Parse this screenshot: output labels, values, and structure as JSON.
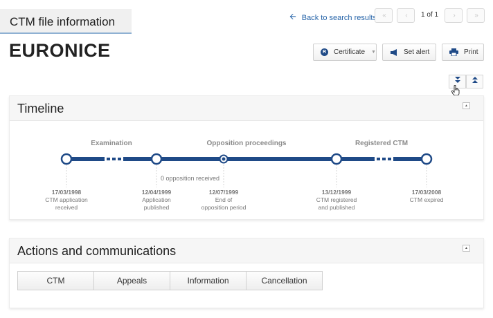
{
  "header": {
    "file_tab": "CTM file information",
    "back_link": "Back to search results",
    "pager": {
      "count": "1 of 1",
      "first": "«",
      "prev": "‹",
      "next": "›",
      "last": "»"
    }
  },
  "title": "EURONICE",
  "toolbar": {
    "certificate_icon_glyph": "R",
    "certificate": "Certificate",
    "set_alert": "Set alert",
    "print": "Print"
  },
  "icons": {
    "back": "arrow-left-icon",
    "certificate": "certificate-r-icon",
    "alert": "megaphone-icon",
    "print": "printer-icon",
    "expand_all": "expand-all-icon",
    "collapse_all": "collapse-all-icon",
    "panel_collapse": "collapse-icon",
    "cursor": "hand-cursor-icon"
  },
  "colors": {
    "accent": "#1f4a87",
    "link": "#2563a8",
    "phase_label": "#8a8a8a",
    "tab_underline": "#8fb1d3"
  },
  "timeline": {
    "title": "Timeline",
    "phases": [
      "Examination",
      "Opposition proceedings",
      "Registered CTM"
    ],
    "note": "0 opposition received",
    "events": [
      {
        "date": "17/03/1998",
        "lines": [
          "CTM application",
          "received"
        ]
      },
      {
        "date": "12/04/1999",
        "lines": [
          "Application",
          "published"
        ]
      },
      {
        "date": "12/07/1999",
        "lines": [
          "End of",
          "opposition period"
        ]
      },
      {
        "date": "13/12/1999",
        "lines": [
          "CTM registered",
          "and published"
        ]
      },
      {
        "date": "17/03/2008",
        "lines": [
          "CTM expired"
        ]
      }
    ]
  },
  "actions": {
    "title": "Actions and communications",
    "tabs": [
      "CTM",
      "Appeals",
      "Information",
      "Cancellation"
    ]
  }
}
